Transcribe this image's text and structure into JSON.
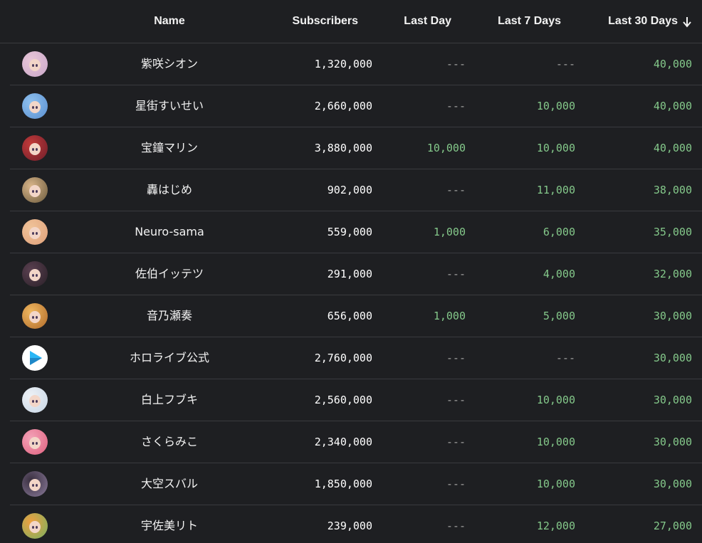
{
  "colors": {
    "background": "#1e1f22",
    "positive_change": "#84c88a",
    "no_change": "#a0a0a0",
    "divider": "#3a3b3f"
  },
  "header": {
    "name": "Name",
    "subscribers": "Subscribers",
    "last_day": "Last Day",
    "last_7_days": "Last 7 Days",
    "last_30_days": "Last 30 Days",
    "sort_icon": "arrow-down-icon"
  },
  "rows": [
    {
      "name": "紫咲シオン",
      "subscribers": "1,320,000",
      "last_day": "---",
      "last_7_days": "---",
      "last_30_days": "40,000",
      "avatar_colors": [
        "#e8c6d8",
        "#c9a7c9"
      ]
    },
    {
      "name": "星街すいせい",
      "subscribers": "2,660,000",
      "last_day": "---",
      "last_7_days": "10,000",
      "last_30_days": "40,000",
      "avatar_colors": [
        "#8fc1ef",
        "#5a8fd0"
      ]
    },
    {
      "name": "宝鐘マリン",
      "subscribers": "3,880,000",
      "last_day": "10,000",
      "last_7_days": "10,000",
      "last_30_days": "40,000",
      "avatar_colors": [
        "#c23a3a",
        "#6e1e2a"
      ]
    },
    {
      "name": "轟はじめ",
      "subscribers": "902,000",
      "last_day": "---",
      "last_7_days": "11,000",
      "last_30_days": "38,000",
      "avatar_colors": [
        "#d9b58a",
        "#6b5a3c"
      ]
    },
    {
      "name": "Neuro-sama",
      "subscribers": "559,000",
      "last_day": "1,000",
      "last_7_days": "6,000",
      "last_30_days": "35,000",
      "avatar_colors": [
        "#f0c49a",
        "#e0a07a"
      ]
    },
    {
      "name": "佐伯イッテツ",
      "subscribers": "291,000",
      "last_day": "---",
      "last_7_days": "4,000",
      "last_30_days": "32,000",
      "avatar_colors": [
        "#5a4050",
        "#2a2028"
      ]
    },
    {
      "name": "音乃瀬奏",
      "subscribers": "656,000",
      "last_day": "1,000",
      "last_7_days": "5,000",
      "last_30_days": "30,000",
      "avatar_colors": [
        "#f0b860",
        "#b06a2a"
      ]
    },
    {
      "name": "ホロライブ公式",
      "subscribers": "2,760,000",
      "last_day": "---",
      "last_7_days": "---",
      "last_30_days": "30,000",
      "avatar_colors": [
        "#ffffff",
        "#29b6f6"
      ]
    },
    {
      "name": "白上フブキ",
      "subscribers": "2,560,000",
      "last_day": "---",
      "last_7_days": "10,000",
      "last_30_days": "30,000",
      "avatar_colors": [
        "#eef1f5",
        "#c8d6e6"
      ]
    },
    {
      "name": "さくらみこ",
      "subscribers": "2,340,000",
      "last_day": "---",
      "last_7_days": "10,000",
      "last_30_days": "30,000",
      "avatar_colors": [
        "#f3a3b8",
        "#e0607e"
      ]
    },
    {
      "name": "大空スバル",
      "subscribers": "1,850,000",
      "last_day": "---",
      "last_7_days": "10,000",
      "last_30_days": "30,000",
      "avatar_colors": [
        "#3a3040",
        "#8a7a9a"
      ]
    },
    {
      "name": "宇佐美リト",
      "subscribers": "239,000",
      "last_day": "---",
      "last_7_days": "12,000",
      "last_30_days": "27,000",
      "avatar_colors": [
        "#f0a040",
        "#78b060"
      ]
    }
  ]
}
